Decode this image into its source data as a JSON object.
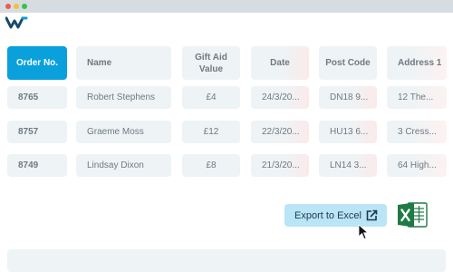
{
  "window": {
    "controls": [
      "close",
      "minimize",
      "maximize"
    ]
  },
  "brand": {
    "logo_icon": "w-logo-icon",
    "color": "#1a4a6a"
  },
  "table": {
    "headers": {
      "order_no": "Order No.",
      "name": "Name",
      "gift_aid_line1": "Gift Aid",
      "gift_aid_line2": "Value",
      "date": "Date",
      "post_code": "Post Code",
      "address": "Address 1"
    },
    "rows": [
      {
        "order_no": "8765",
        "name": "Robert Stephens",
        "gift_aid": "£4",
        "date": "24/3/20...",
        "post_code": "DN18 9...",
        "address": "12 The..."
      },
      {
        "order_no": "8757",
        "name": "Graeme Moss",
        "gift_aid": "£12",
        "date": "22/3/20...",
        "post_code": "HU13 6...",
        "address": "3 Cress..."
      },
      {
        "order_no": "8749",
        "name": "Lindsay Dixon",
        "gift_aid": "£8",
        "date": "21/3/20...",
        "post_code": "LN14 3...",
        "address": "64 High..."
      }
    ]
  },
  "export": {
    "label": "Export to Excel",
    "icon": "share-icon",
    "app_icon": "excel-icon"
  },
  "colors": {
    "accent": "#0aa0dc",
    "button": "#b9e5f6",
    "excel_green": "#1f7a45"
  }
}
